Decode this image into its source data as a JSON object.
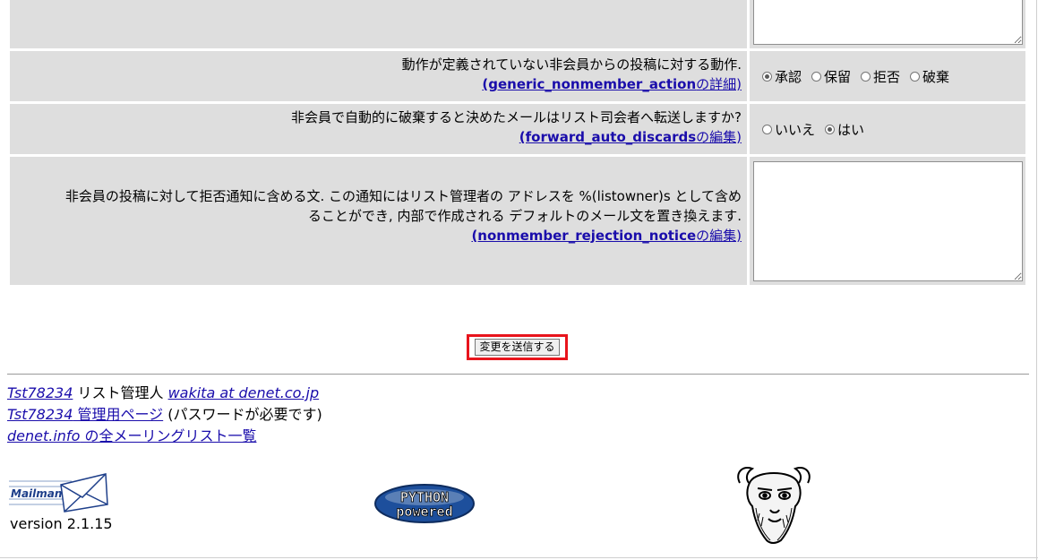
{
  "rows": [
    {
      "desc_lines": [
        "動作が定義されていない非会員からの投稿に対する動作."
      ],
      "link_code": "(generic_nonmember_action",
      "link_suffix": "の詳細)",
      "options": [
        {
          "label": "承認",
          "checked": true
        },
        {
          "label": "保留",
          "checked": false
        },
        {
          "label": "拒否",
          "checked": false
        },
        {
          "label": "破棄",
          "checked": false
        }
      ]
    },
    {
      "desc_lines": [
        "非会員で自動的に破棄すると決めたメールはリスト司会者へ転送しますか?"
      ],
      "link_code": "(forward_auto_discards",
      "link_suffix": "の編集)",
      "options": [
        {
          "label": "いいえ",
          "checked": false
        },
        {
          "label": "はい",
          "checked": true
        }
      ]
    },
    {
      "desc_lines": [
        "非会員の投稿に対して拒否通知に含める文. この通知にはリスト管理者の アドレスを %(listowner)s として含め",
        "ることができ, 内部で作成される デフォルトのメール文を置き換えます."
      ],
      "link_code": "(nonmember_rejection_notice",
      "link_suffix": "の編集)",
      "textarea_value": ""
    }
  ],
  "submit": {
    "label": "変更を送信する"
  },
  "footer": {
    "list_name": "Tst78234",
    "owner_text": " リスト管理人 ",
    "owner_email": "wakita at denet.co.jp",
    "admin_list_name": "Tst78234",
    "admin_page_link": " 管理用ページ",
    "password_note": " (パスワードが必要です)",
    "all_lists_domain": "denet.info",
    "all_lists_text": " の全メーリングリスト一覧",
    "version": "version 2.1.15"
  },
  "logos": {
    "mailman": "Mailman",
    "python_top": "PYTHON",
    "python_bottom": "powered"
  },
  "icons": {
    "mailman": "envelope-icon",
    "python": "python-powered-logo",
    "gnu": "gnu-head-logo"
  }
}
